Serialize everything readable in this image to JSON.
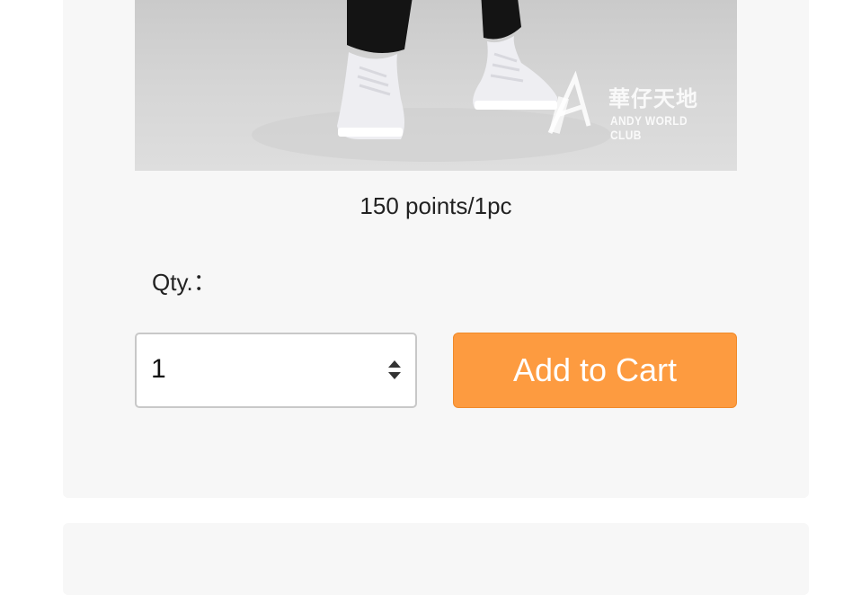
{
  "product": {
    "image_icon": "sneaker-photo",
    "watermark_zh": "華仔天地",
    "watermark_en": "ANDY WORLD CLUB",
    "price": "150 points/1pc"
  },
  "quantity": {
    "label": "Qty.：",
    "value": "1"
  },
  "cart": {
    "button_label": "Add to Cart",
    "button_color": "#fd9b40"
  }
}
